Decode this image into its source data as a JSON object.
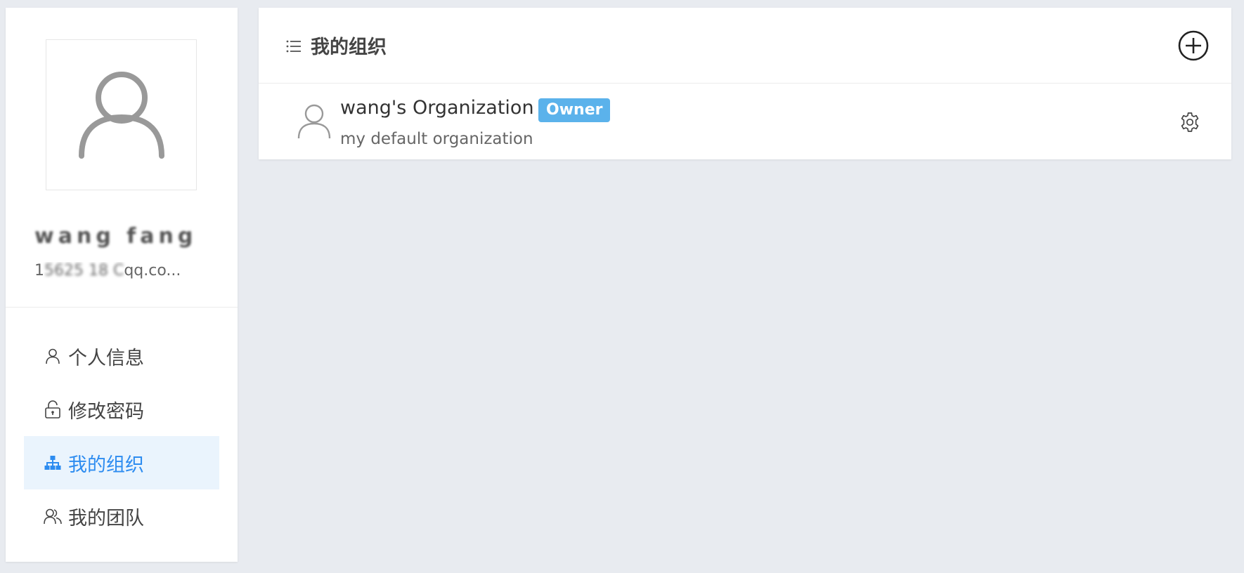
{
  "user": {
    "name": "wang fang",
    "email_visible": "1",
    "email_hidden": "5625 18 C",
    "email_suffix": "qq.co..."
  },
  "menu": {
    "items": [
      {
        "label": "个人信息",
        "icon": "user-icon",
        "active": false
      },
      {
        "label": "修改密码",
        "icon": "lock-icon",
        "active": false
      },
      {
        "label": "我的组织",
        "icon": "sitemap-icon",
        "active": true
      },
      {
        "label": "我的团队",
        "icon": "team-icon",
        "active": false
      }
    ]
  },
  "panel": {
    "title": "我的组织",
    "title_icon": "list-icon",
    "add_icon": "plus-circle-icon"
  },
  "organizations": [
    {
      "name": "wang's Organization",
      "badge": "Owner",
      "description": "my default organization",
      "avatar_icon": "user-icon",
      "settings_icon": "gear-icon"
    }
  ],
  "colors": {
    "page_bg": "#e8ebf0",
    "accent": "#2d8cf0",
    "active_bg": "#eaf4fd",
    "badge_bg": "#5bb2eb"
  }
}
